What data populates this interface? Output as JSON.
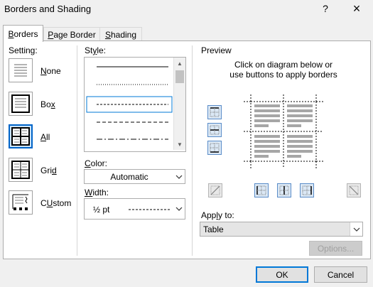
{
  "window": {
    "title": "Borders and Shading"
  },
  "title_buttons": {
    "help": "?",
    "close": "×"
  },
  "tabs": [
    {
      "label": "Borders",
      "underline": "B",
      "rest": "orders",
      "active": true
    },
    {
      "label": "Page Border",
      "underline": "P",
      "rest": "age Border",
      "active": false
    },
    {
      "label": "Shading",
      "underline": "S",
      "rest": "hading",
      "active": false
    }
  ],
  "setting": {
    "heading": "Setting:",
    "items": [
      {
        "label": "None",
        "ul": "N",
        "rest": "one"
      },
      {
        "label": "Box",
        "ul": "x",
        "pre": "Bo"
      },
      {
        "label": "All",
        "ul": "A",
        "rest": "ll",
        "selected": true
      },
      {
        "label": "Grid",
        "ul": "d",
        "pre": "Gri"
      },
      {
        "label": "Custom",
        "ul": "U",
        "pre": "C",
        "rest": "stom"
      }
    ]
  },
  "style": {
    "heading_pre": "St",
    "heading_ul": "y",
    "heading_rest": "le:",
    "line_styles": [
      "solid",
      "dotted",
      "dashed-fine",
      "dashed",
      "dash-dot"
    ],
    "selected_index": 2
  },
  "color": {
    "heading_pre": "",
    "heading_ul": "C",
    "heading_rest": "olor:",
    "value": "Automatic"
  },
  "width": {
    "heading_pre": "",
    "heading_ul": "W",
    "heading_rest": "idth:",
    "value": "½ pt"
  },
  "preview": {
    "heading": "Preview",
    "instruction_line1": "Click on diagram below or",
    "instruction_line2": "use buttons to apply borders"
  },
  "apply_to": {
    "heading_pre": "App",
    "heading_ul": "l",
    "heading_rest": "y to:",
    "value": "Table"
  },
  "options_button": {
    "label": "Options..."
  },
  "footer": {
    "ok": "OK",
    "cancel": "Cancel"
  }
}
